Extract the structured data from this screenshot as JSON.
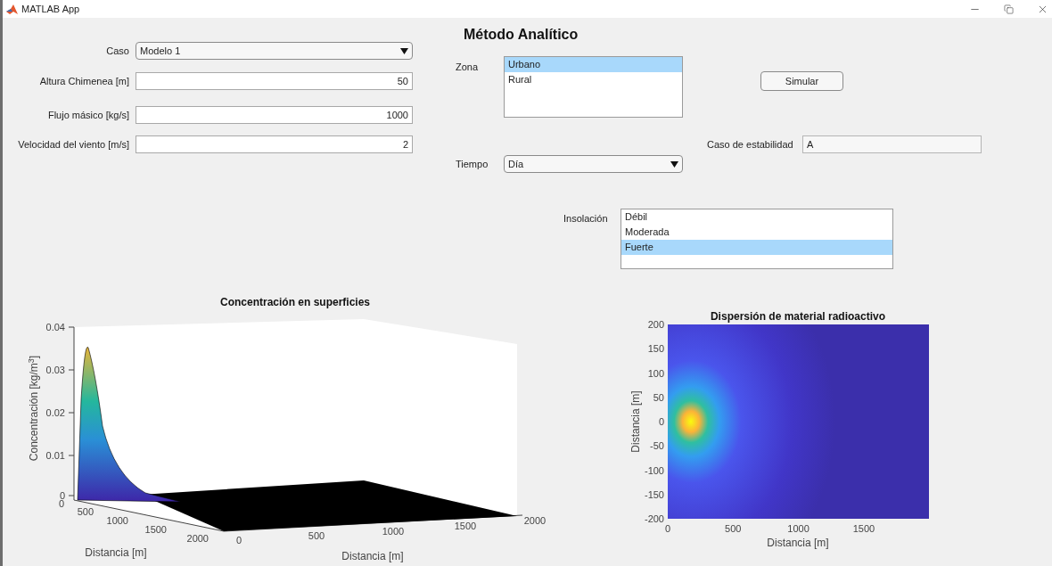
{
  "window": {
    "title": "MATLAB App"
  },
  "heading": "Método Analítico",
  "fields": [
    {
      "label": "Caso",
      "kind": "dropdown",
      "value": "Modelo 1"
    },
    {
      "label": "Altura Chimenea [m]",
      "kind": "number",
      "value": "50"
    },
    {
      "label": "Flujo másico [kg/s]",
      "kind": "number",
      "value": "1000"
    },
    {
      "label": "Velocidad del viento [m/s]",
      "kind": "number",
      "value": "2"
    }
  ],
  "zona": {
    "label": "Zona",
    "items": [
      {
        "label": "Urbano",
        "selected": true
      },
      {
        "label": "Rural",
        "selected": false
      }
    ]
  },
  "tiempo": {
    "label": "Tiempo",
    "value": "Día"
  },
  "simular_button": "Simular",
  "estabilidad": {
    "label": "Caso de estabilidad",
    "value": "A"
  },
  "insolacion": {
    "label": "Insolación",
    "items": [
      {
        "label": "Débil",
        "selected": false
      },
      {
        "label": "Moderada",
        "selected": false
      },
      {
        "label": "Fuerte",
        "selected": true
      }
    ]
  },
  "surface_plot": {
    "title": "Concentración en superficies",
    "zlabel": "Concentración  [kg/m$^{3}$]",
    "zticks": [
      "0.04",
      "0.03",
      "0.02",
      "0.01",
      "0"
    ],
    "ylabel": "Distancia [m]",
    "yticks": [
      "0",
      "500",
      "1000",
      "1500",
      "2000"
    ],
    "xlabel": "Distancia [m]",
    "xticks": [
      "0",
      "500",
      "1000",
      "1500",
      "2000"
    ]
  },
  "heatmap": {
    "title": "Dispersión de material radioactivo",
    "ylabel": "Distancia [m]",
    "yticks": [
      "200",
      "150",
      "100",
      "50",
      "0",
      "-50",
      "-100",
      "-150",
      "-200"
    ],
    "xlabel": "Distancia [m]",
    "xticks": [
      "0",
      "500",
      "1000",
      "1500"
    ]
  }
}
